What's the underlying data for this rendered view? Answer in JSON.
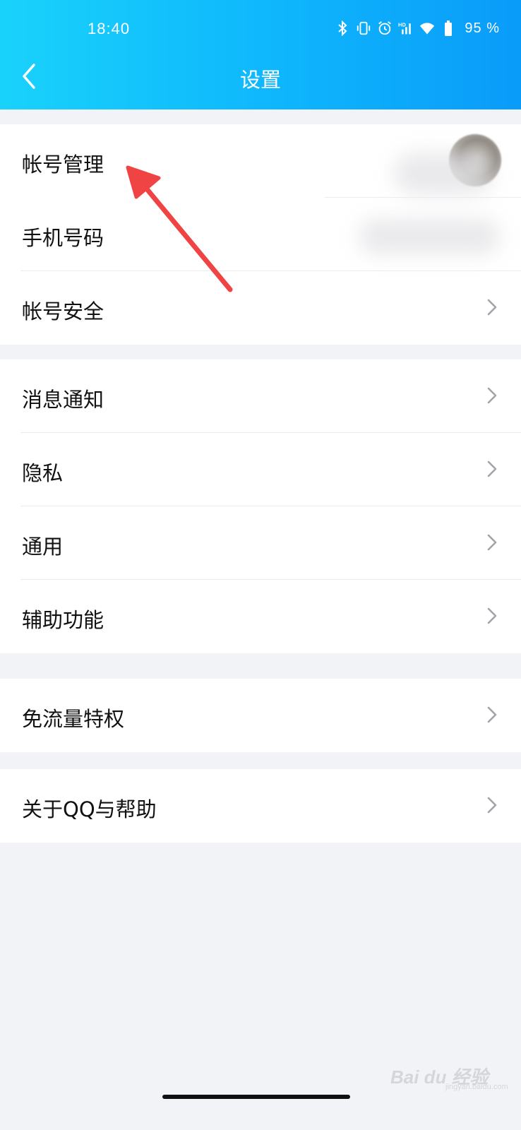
{
  "status_bar": {
    "time": "18:40",
    "battery_percent": "95 %",
    "icons": [
      "bluetooth-icon",
      "vibrate-icon",
      "alarm-icon",
      "hd-signal-icon",
      "wifi-icon",
      "battery-icon"
    ]
  },
  "header": {
    "title": "设置",
    "gradient_colors": [
      "#19d2fb",
      "#0a9bf9"
    ]
  },
  "sections": [
    {
      "rows": [
        {
          "label": "帐号管理",
          "trailing": "avatar"
        },
        {
          "label": "手机号码",
          "trailing": "hidden-value"
        },
        {
          "label": "帐号安全",
          "trailing": "chevron"
        }
      ]
    },
    {
      "rows": [
        {
          "label": "消息通知",
          "trailing": "chevron"
        },
        {
          "label": "隐私",
          "trailing": "chevron"
        },
        {
          "label": "通用",
          "trailing": "chevron"
        },
        {
          "label": "辅助功能",
          "trailing": "chevron"
        }
      ]
    },
    {
      "rows": [
        {
          "label": "免流量特权",
          "trailing": "chevron"
        }
      ]
    },
    {
      "rows": [
        {
          "label": "关于QQ与帮助",
          "trailing": "chevron"
        }
      ]
    }
  ],
  "annotation": {
    "color": "#f04444",
    "icon": "red-arrow-annotation"
  },
  "watermark": {
    "text": "Bai du 经验",
    "sub": "jingyan.baidu.com"
  }
}
